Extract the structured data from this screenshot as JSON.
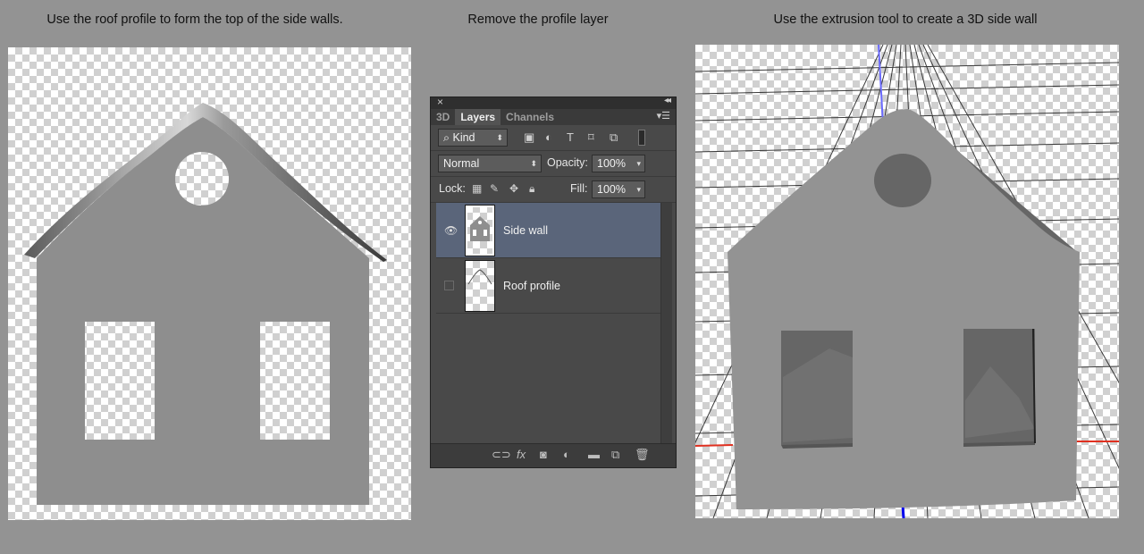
{
  "captions": {
    "left": "Use the roof profile to form the top of the side walls.",
    "middle": "Remove the profile layer",
    "right": "Use the extrusion tool to create a 3D side wall"
  },
  "colors": {
    "background": "#939393",
    "wall": "#8e8e8e",
    "panel": "#494949",
    "selected_layer": "#5a657a",
    "axis_blue": "#2222ff",
    "axis_red": "#e03020"
  },
  "layers_panel": {
    "close_icon": "close-icon",
    "tabs": [
      {
        "label": "3D"
      },
      {
        "label": "Layers"
      },
      {
        "label": "Channels"
      }
    ],
    "filter": {
      "label": "Kind"
    },
    "filter_icons": [
      "image-icon",
      "adjustment-icon",
      "type-icon",
      "shape-icon",
      "smart-object-icon"
    ],
    "blend_mode": "Normal",
    "opacity_label": "Opacity:",
    "opacity_value": "100%",
    "lock_label": "Lock:",
    "fill_label": "Fill:",
    "fill_value": "100%",
    "layers": [
      {
        "name": "Side wall",
        "visible": true,
        "selected": true
      },
      {
        "name": "Roof profile",
        "visible": false,
        "selected": false
      }
    ],
    "bottom_icons": [
      "link-icon",
      "fx-icon",
      "mask-icon",
      "adjustment-layer-icon",
      "folder-icon",
      "new-layer-icon",
      "trash-icon"
    ],
    "fx_label": "fx"
  }
}
